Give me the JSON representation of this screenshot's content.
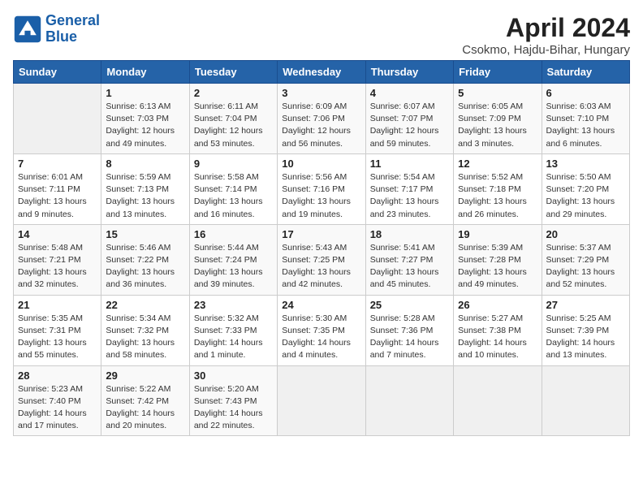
{
  "logo": {
    "text_general": "General",
    "text_blue": "Blue"
  },
  "title": "April 2024",
  "subtitle": "Csokmo, Hajdu-Bihar, Hungary",
  "weekdays": [
    "Sunday",
    "Monday",
    "Tuesday",
    "Wednesday",
    "Thursday",
    "Friday",
    "Saturday"
  ],
  "weeks": [
    [
      {
        "day": "",
        "info": ""
      },
      {
        "day": "1",
        "info": "Sunrise: 6:13 AM\nSunset: 7:03 PM\nDaylight: 12 hours\nand 49 minutes."
      },
      {
        "day": "2",
        "info": "Sunrise: 6:11 AM\nSunset: 7:04 PM\nDaylight: 12 hours\nand 53 minutes."
      },
      {
        "day": "3",
        "info": "Sunrise: 6:09 AM\nSunset: 7:06 PM\nDaylight: 12 hours\nand 56 minutes."
      },
      {
        "day": "4",
        "info": "Sunrise: 6:07 AM\nSunset: 7:07 PM\nDaylight: 12 hours\nand 59 minutes."
      },
      {
        "day": "5",
        "info": "Sunrise: 6:05 AM\nSunset: 7:09 PM\nDaylight: 13 hours\nand 3 minutes."
      },
      {
        "day": "6",
        "info": "Sunrise: 6:03 AM\nSunset: 7:10 PM\nDaylight: 13 hours\nand 6 minutes."
      }
    ],
    [
      {
        "day": "7",
        "info": "Sunrise: 6:01 AM\nSunset: 7:11 PM\nDaylight: 13 hours\nand 9 minutes."
      },
      {
        "day": "8",
        "info": "Sunrise: 5:59 AM\nSunset: 7:13 PM\nDaylight: 13 hours\nand 13 minutes."
      },
      {
        "day": "9",
        "info": "Sunrise: 5:58 AM\nSunset: 7:14 PM\nDaylight: 13 hours\nand 16 minutes."
      },
      {
        "day": "10",
        "info": "Sunrise: 5:56 AM\nSunset: 7:16 PM\nDaylight: 13 hours\nand 19 minutes."
      },
      {
        "day": "11",
        "info": "Sunrise: 5:54 AM\nSunset: 7:17 PM\nDaylight: 13 hours\nand 23 minutes."
      },
      {
        "day": "12",
        "info": "Sunrise: 5:52 AM\nSunset: 7:18 PM\nDaylight: 13 hours\nand 26 minutes."
      },
      {
        "day": "13",
        "info": "Sunrise: 5:50 AM\nSunset: 7:20 PM\nDaylight: 13 hours\nand 29 minutes."
      }
    ],
    [
      {
        "day": "14",
        "info": "Sunrise: 5:48 AM\nSunset: 7:21 PM\nDaylight: 13 hours\nand 32 minutes."
      },
      {
        "day": "15",
        "info": "Sunrise: 5:46 AM\nSunset: 7:22 PM\nDaylight: 13 hours\nand 36 minutes."
      },
      {
        "day": "16",
        "info": "Sunrise: 5:44 AM\nSunset: 7:24 PM\nDaylight: 13 hours\nand 39 minutes."
      },
      {
        "day": "17",
        "info": "Sunrise: 5:43 AM\nSunset: 7:25 PM\nDaylight: 13 hours\nand 42 minutes."
      },
      {
        "day": "18",
        "info": "Sunrise: 5:41 AM\nSunset: 7:27 PM\nDaylight: 13 hours\nand 45 minutes."
      },
      {
        "day": "19",
        "info": "Sunrise: 5:39 AM\nSunset: 7:28 PM\nDaylight: 13 hours\nand 49 minutes."
      },
      {
        "day": "20",
        "info": "Sunrise: 5:37 AM\nSunset: 7:29 PM\nDaylight: 13 hours\nand 52 minutes."
      }
    ],
    [
      {
        "day": "21",
        "info": "Sunrise: 5:35 AM\nSunset: 7:31 PM\nDaylight: 13 hours\nand 55 minutes."
      },
      {
        "day": "22",
        "info": "Sunrise: 5:34 AM\nSunset: 7:32 PM\nDaylight: 13 hours\nand 58 minutes."
      },
      {
        "day": "23",
        "info": "Sunrise: 5:32 AM\nSunset: 7:33 PM\nDaylight: 14 hours\nand 1 minute."
      },
      {
        "day": "24",
        "info": "Sunrise: 5:30 AM\nSunset: 7:35 PM\nDaylight: 14 hours\nand 4 minutes."
      },
      {
        "day": "25",
        "info": "Sunrise: 5:28 AM\nSunset: 7:36 PM\nDaylight: 14 hours\nand 7 minutes."
      },
      {
        "day": "26",
        "info": "Sunrise: 5:27 AM\nSunset: 7:38 PM\nDaylight: 14 hours\nand 10 minutes."
      },
      {
        "day": "27",
        "info": "Sunrise: 5:25 AM\nSunset: 7:39 PM\nDaylight: 14 hours\nand 13 minutes."
      }
    ],
    [
      {
        "day": "28",
        "info": "Sunrise: 5:23 AM\nSunset: 7:40 PM\nDaylight: 14 hours\nand 17 minutes."
      },
      {
        "day": "29",
        "info": "Sunrise: 5:22 AM\nSunset: 7:42 PM\nDaylight: 14 hours\nand 20 minutes."
      },
      {
        "day": "30",
        "info": "Sunrise: 5:20 AM\nSunset: 7:43 PM\nDaylight: 14 hours\nand 22 minutes."
      },
      {
        "day": "",
        "info": ""
      },
      {
        "day": "",
        "info": ""
      },
      {
        "day": "",
        "info": ""
      },
      {
        "day": "",
        "info": ""
      }
    ]
  ]
}
